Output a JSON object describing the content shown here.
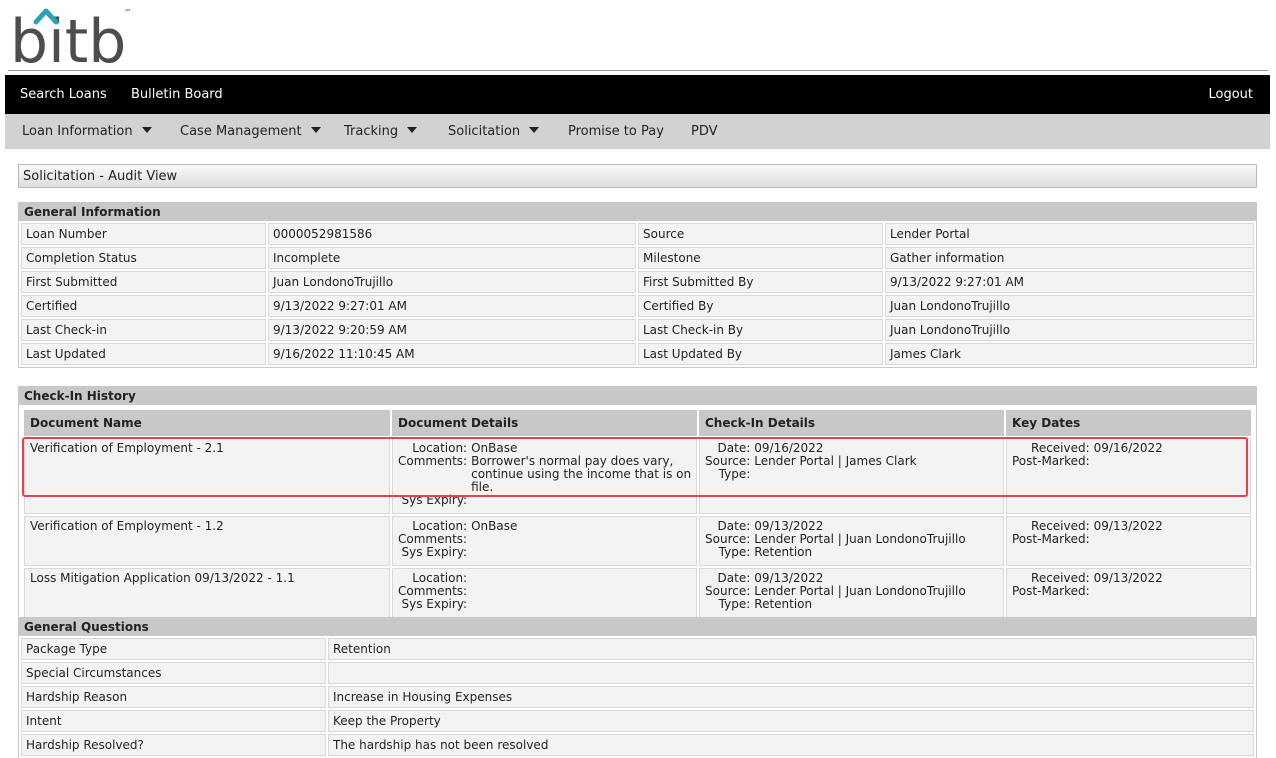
{
  "brand": {
    "logo_text": "bitb",
    "trademark": "™"
  },
  "top_nav": {
    "left_items": [
      "Search Loans",
      "Bulletin Board"
    ],
    "logout": "Logout"
  },
  "sub_nav": [
    {
      "label": "Loan Information",
      "dropdown": true
    },
    {
      "label": "Case Management",
      "dropdown": true
    },
    {
      "label": "Tracking",
      "dropdown": true
    },
    {
      "label": "Solicitation",
      "dropdown": true
    },
    {
      "label": "Promise to Pay",
      "dropdown": false
    },
    {
      "label": "PDV",
      "dropdown": false
    }
  ],
  "page_title": "Solicitation - Audit View",
  "general_information": {
    "title": "General Information",
    "rows": [
      [
        "Loan Number",
        "0000052981586",
        "Source",
        "Lender Portal"
      ],
      [
        "Completion Status",
        "Incomplete",
        "Milestone",
        "Gather information"
      ],
      [
        "First Submitted",
        "Juan LondonoTrujillo",
        "First Submitted By",
        "9/13/2022 9:27:01 AM"
      ],
      [
        "Certified",
        "9/13/2022 9:27:01 AM",
        "Certified By",
        "Juan LondonoTrujillo"
      ],
      [
        "Last Check-in",
        "9/13/2022 9:20:59 AM",
        "Last Check-in By",
        "Juan LondonoTrujillo"
      ],
      [
        "Last Updated",
        "9/16/2022 11:10:45 AM",
        "Last Updated By",
        "James Clark"
      ]
    ]
  },
  "checkin_history": {
    "title": "Check-In History",
    "columns": [
      "Document Name",
      "Document Details",
      "Check-In Details",
      "Key Dates"
    ],
    "detail_labels": {
      "location": "Location:",
      "comments": "Comments:",
      "sys_expiry": "Sys Expiry:",
      "date": "Date:",
      "source": "Source:",
      "type": "Type:",
      "received": "Received:",
      "post_marked": "Post-Marked:"
    },
    "rows": [
      {
        "document_name": "Verification of Employment - 2.1",
        "location": "OnBase",
        "comments": "Borrower's normal pay does vary, continue using the income that is on file.",
        "sys_expiry": "",
        "date": "09/16/2022",
        "source": "Lender Portal | James Clark",
        "type": "",
        "received": "09/16/2022",
        "post_marked": "",
        "highlighted": true
      },
      {
        "document_name": "Verification of Employment - 1.2",
        "location": "OnBase",
        "comments": "",
        "sys_expiry": "",
        "date": "09/13/2022",
        "source": "Lender Portal | Juan LondonoTrujillo",
        "type": "Retention",
        "received": "09/13/2022",
        "post_marked": "",
        "highlighted": false
      },
      {
        "document_name": "Loss Mitigation Application 09/13/2022 - 1.1",
        "location": "",
        "comments": "",
        "sys_expiry": "",
        "date": "09/13/2022",
        "source": "Lender Portal | Juan LondonoTrujillo",
        "type": "Retention",
        "received": "09/13/2022",
        "post_marked": "",
        "highlighted": false
      }
    ]
  },
  "general_questions": {
    "title": "General Questions",
    "rows": [
      [
        "Package Type",
        "Retention"
      ],
      [
        "Special Circumstances",
        ""
      ],
      [
        "Hardship Reason",
        "Increase in Housing Expenses"
      ],
      [
        "Intent",
        "Keep the Property"
      ],
      [
        "Hardship Resolved?",
        "The hardship has not been resolved"
      ]
    ]
  },
  "colors": {
    "nav_bg": "#000000",
    "subnav_bg": "#d2d2d2",
    "header_bg": "#c8c8c8",
    "highlight": "#e8414a",
    "logo": "#4d4d4d",
    "logo_accent": "#2ba3b4"
  }
}
